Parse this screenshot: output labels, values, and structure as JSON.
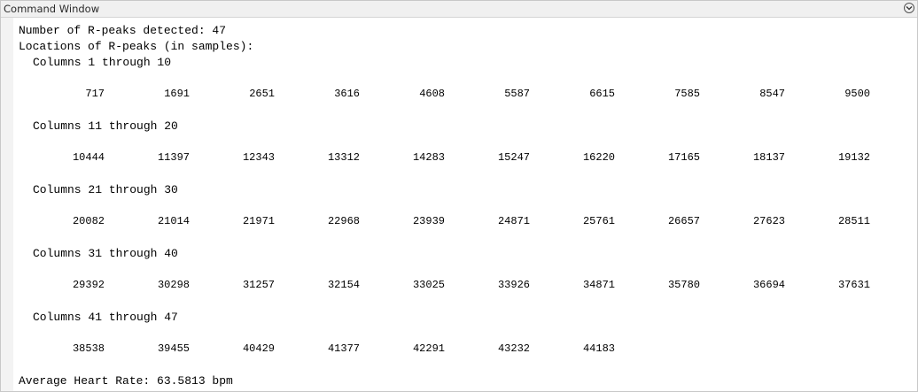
{
  "window": {
    "title": "Command Window",
    "menu_icon": "chevron-down-circle-icon"
  },
  "output": {
    "count_line": "Number of R-peaks detected: 47",
    "locations_line": "Locations of R-peaks (in samples):",
    "blocks": [
      {
        "header": "Columns 1 through 10",
        "values": [
          "717",
          "1691",
          "2651",
          "3616",
          "4608",
          "5587",
          "6615",
          "7585",
          "8547",
          "9500"
        ]
      },
      {
        "header": "Columns 11 through 20",
        "values": [
          "10444",
          "11397",
          "12343",
          "13312",
          "14283",
          "15247",
          "16220",
          "17165",
          "18137",
          "19132"
        ]
      },
      {
        "header": "Columns 21 through 30",
        "values": [
          "20082",
          "21014",
          "21971",
          "22968",
          "23939",
          "24871",
          "25761",
          "26657",
          "27623",
          "28511"
        ]
      },
      {
        "header": "Columns 31 through 40",
        "values": [
          "29392",
          "30298",
          "31257",
          "32154",
          "33025",
          "33926",
          "34871",
          "35780",
          "36694",
          "37631"
        ]
      },
      {
        "header": "Columns 41 through 47",
        "values": [
          "38538",
          "39455",
          "40429",
          "41377",
          "42291",
          "43232",
          "44183"
        ]
      }
    ],
    "heart_rate_line": "Average Heart Rate: 63.5813 bpm"
  }
}
